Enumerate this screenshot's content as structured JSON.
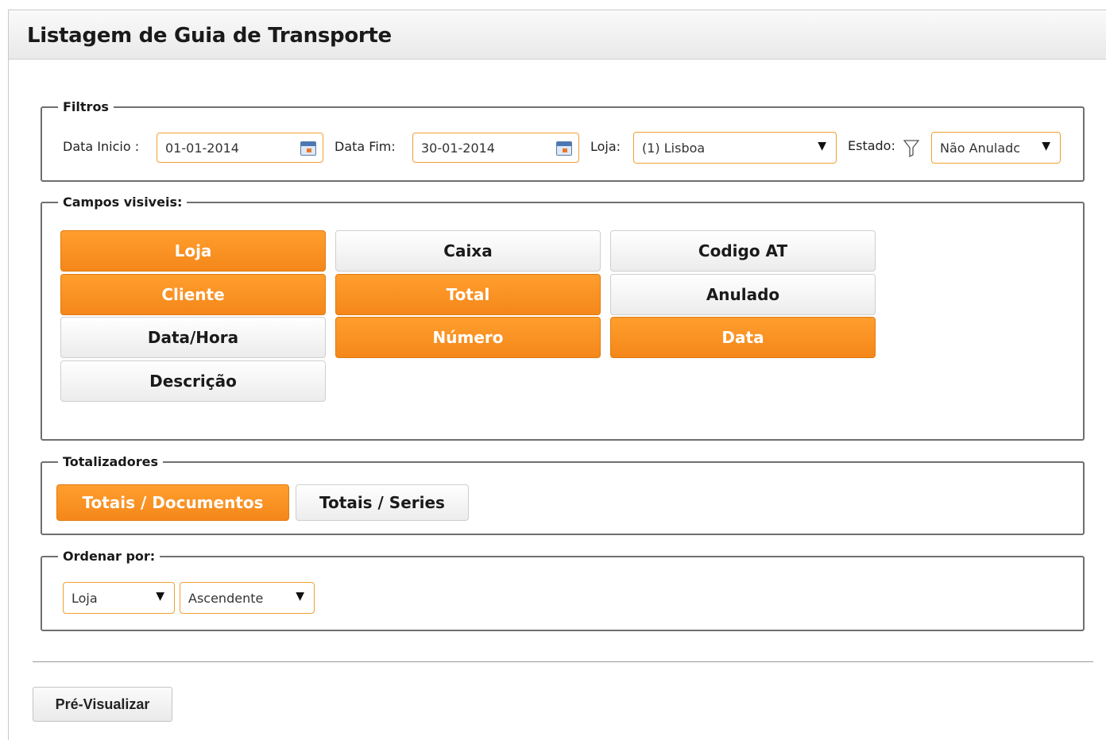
{
  "page": {
    "title": "Listagem de Guia de Transporte"
  },
  "filtros": {
    "legend": "Filtros",
    "data_inicio_label": "Data Inicio :",
    "data_inicio_value": "01-01-2014",
    "data_fim_label": "Data Fim:",
    "data_fim_value": "30-01-2014",
    "loja_label": "Loja:",
    "loja_value": "(1) Lisboa",
    "estado_label": "Estado:",
    "estado_value": "Não Anuladc"
  },
  "campos": {
    "legend": "Campos visiveis:",
    "items": [
      {
        "label": "Loja",
        "selected": true
      },
      {
        "label": "Caixa",
        "selected": false
      },
      {
        "label": "Codigo AT",
        "selected": false
      },
      {
        "label": "Cliente",
        "selected": true
      },
      {
        "label": "Total",
        "selected": true
      },
      {
        "label": "Anulado",
        "selected": false
      },
      {
        "label": "Data/Hora",
        "selected": false
      },
      {
        "label": "Número",
        "selected": true
      },
      {
        "label": "Data",
        "selected": true
      },
      {
        "label": "Descrição",
        "selected": false
      }
    ]
  },
  "totalizadores": {
    "legend": "Totalizadores",
    "options": [
      {
        "label": "Totais / Documentos",
        "selected": true
      },
      {
        "label": "Totais / Series",
        "selected": false
      }
    ]
  },
  "ordenar": {
    "legend": "Ordenar por:",
    "field_value": "Loja",
    "direction_value": "Ascendente"
  },
  "actions": {
    "preview_label": "Pré-Visualizar"
  },
  "colors": {
    "accent": "#f5871a",
    "field_border": "#f0a030"
  },
  "icons": {
    "calendar": "calendar-icon",
    "dropdown": "chevron-down-icon",
    "filter": "filter-icon"
  }
}
